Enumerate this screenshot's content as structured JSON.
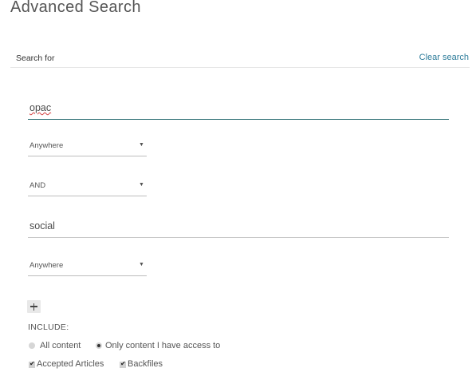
{
  "page": {
    "title": "Advanced Search"
  },
  "search": {
    "section_label": "Search for",
    "clear_label": "Clear search",
    "field_1_value": "opac",
    "location_1": "Anywhere",
    "operator": "AND",
    "field_2_value": "social",
    "location_2": "Anywhere",
    "add_label": "+"
  },
  "include": {
    "label": "INCLUDE:",
    "options": [
      {
        "label": "All content",
        "checked": false
      },
      {
        "label": "Only content I have access to",
        "checked": true
      }
    ],
    "filters": [
      {
        "label": "Accepted Articles",
        "checked": true
      },
      {
        "label": "Backfiles",
        "checked": true
      }
    ]
  },
  "icons": {
    "select_chevron": "chevron-down-icon",
    "checkbox_mark": "check-icon",
    "add": "plus-icon"
  },
  "colors": {
    "accent_link": "#2f7d9b",
    "active_field_underline": "#2c6d73",
    "spellcheck_underline": "#d43c3c"
  }
}
